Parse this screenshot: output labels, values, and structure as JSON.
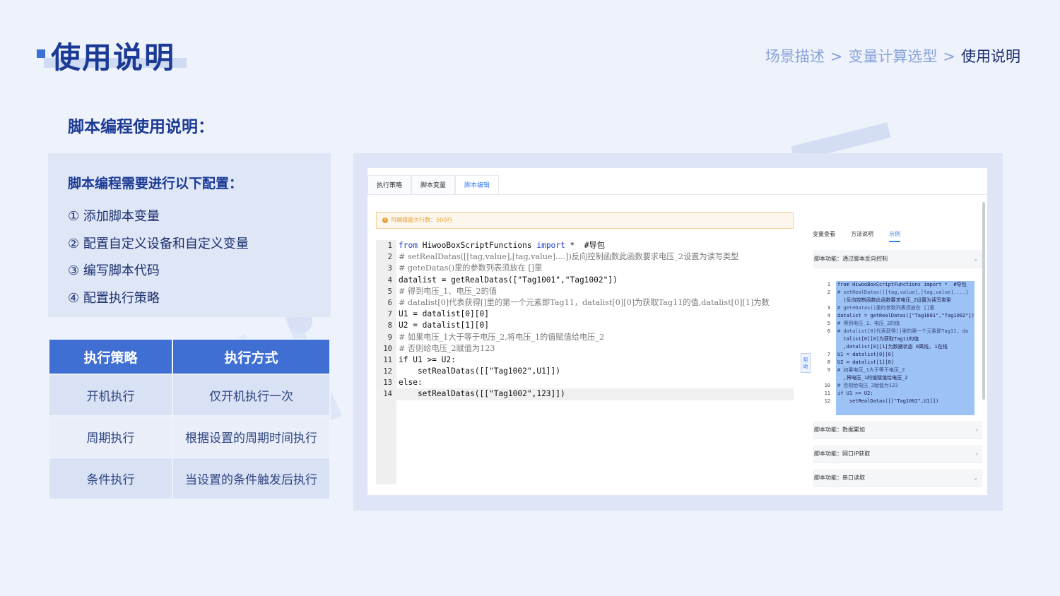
{
  "header": {
    "title": "使用说明",
    "breadcrumb": [
      "场景描述",
      "变量计算选型",
      "使用说明"
    ],
    "breadcrumb_sep": ">"
  },
  "section_title": "脚本编程使用说明：",
  "config": {
    "heading": "脚本编程需要进行以下配置：",
    "items": [
      "① 添加脚本变量",
      "② 配置自定义设备和自定义变量",
      "③ 编写脚本代码",
      "④ 配置执行策略"
    ]
  },
  "strategy_table": {
    "headers": [
      "执行策略",
      "执行方式"
    ],
    "rows": [
      [
        "开机执行",
        "仅开机执行一次"
      ],
      [
        "周期执行",
        "根据设置的周期时间执行"
      ],
      [
        "条件执行",
        "当设置的条件触发后执行"
      ]
    ]
  },
  "screenshot": {
    "tabs": [
      "执行策略",
      "脚本变量",
      "脚本编辑"
    ],
    "active_tab": "脚本编辑",
    "notice": "可编辑最大行数：500行",
    "notice_icon": "info-icon",
    "code": [
      {
        "ln": "1",
        "pre": "",
        "kw": "from",
        "mid": " HiwooBoxScriptFunctions ",
        "kw2": "import",
        "post": " *  #导包"
      },
      {
        "ln": "2",
        "comment": "# setRealDatas([[tag,value],[tag,value]....])反向控制函数此函数要求电压_2设置为读写类型"
      },
      {
        "ln": "3",
        "comment": "# geteDatas()里的参数列表须放在 []里"
      },
      {
        "ln": "4",
        "text": "datalist = getRealDatas([\"Tag1001\",\"Tag1002\"])"
      },
      {
        "ln": "5",
        "comment": "# 得到电压_1、电压_2的值"
      },
      {
        "ln": "6",
        "comment": "# datalist[0]代表获得[]里的第一个元素即Tag11，datalist[0][0]为获取Tag11的值,datalist[0][1]为数"
      },
      {
        "ln": "7",
        "text": "U1 = datalist[0][0]"
      },
      {
        "ln": "8",
        "text": "U2 = datalist[1][0]"
      },
      {
        "ln": "9",
        "comment": "# 如果电压_1大于等于电压_2,将电压_1的值赋值给电压_2"
      },
      {
        "ln": "10",
        "comment": "# 否则给电压_2赋值为123"
      },
      {
        "ln": "11",
        "text": "if U1 >= U2:"
      },
      {
        "ln": "12",
        "text": "    setRealDatas([[\"Tag1002\",U1]])"
      },
      {
        "ln": "13",
        "text": "else:"
      },
      {
        "ln": "14",
        "text": "    setRealDatas([[\"Tag1002\",123]])"
      }
    ],
    "help_label": "帮助",
    "side_tabs": [
      "变量查看",
      "方法说明",
      "示例"
    ],
    "side_active_tab": "示例",
    "side_rows": [
      {
        "label": "脚本功能：通过脚本反向控制",
        "arrow": "⌄"
      },
      {
        "label": "脚本功能：数据累加",
        "arrow": "›"
      },
      {
        "label": "脚本功能：网口IP获取",
        "arrow": "›"
      },
      {
        "label": "脚本功能：串口读取",
        "arrow": "⌄"
      }
    ],
    "side_code": [
      {
        "ln": "1",
        "text": "from HiwooBoxScriptFunctions import *  #导包"
      },
      {
        "ln": "2",
        "text": "# setRealDatas([[tag,value],[tag,value]....]"
      },
      {
        "ln": "",
        "text": "  )反向控制函数此函数要求电压_2设置为读写类型"
      },
      {
        "ln": "3",
        "text": "# geteDatas()里的参数列表须放在 []里"
      },
      {
        "ln": "4",
        "text": "datalist = getRealDatas([\"Tag1001\",\"Tag1002\"])"
      },
      {
        "ln": "5",
        "text": "# 得到电压_1、电压_2的值"
      },
      {
        "ln": "6",
        "text": "# datalist[0]代表获得[]里的第一个元素即Tag11, da"
      },
      {
        "ln": "",
        "text": "  talist[0][0]为获取Tag11的值"
      },
      {
        "ln": "",
        "text": "  ,datalist[0][1]为数据状态 0离线, 1在线"
      },
      {
        "ln": "7",
        "text": "U1 = datalist[0][0]"
      },
      {
        "ln": "8",
        "text": "U2 = datalist[1][0]"
      },
      {
        "ln": "9",
        "text": "# 如果电压_1大于等于电压_2"
      },
      {
        "ln": "",
        "text": "  ,将电压_1的值赋值给电压_2"
      },
      {
        "ln": "10",
        "text": "# 否则给电压_2赋值为123"
      },
      {
        "ln": "11",
        "text": "if U1 >= U2:"
      },
      {
        "ln": "12",
        "text": "    setRealDatas([[\"Tag1002\",U1]])"
      }
    ]
  }
}
